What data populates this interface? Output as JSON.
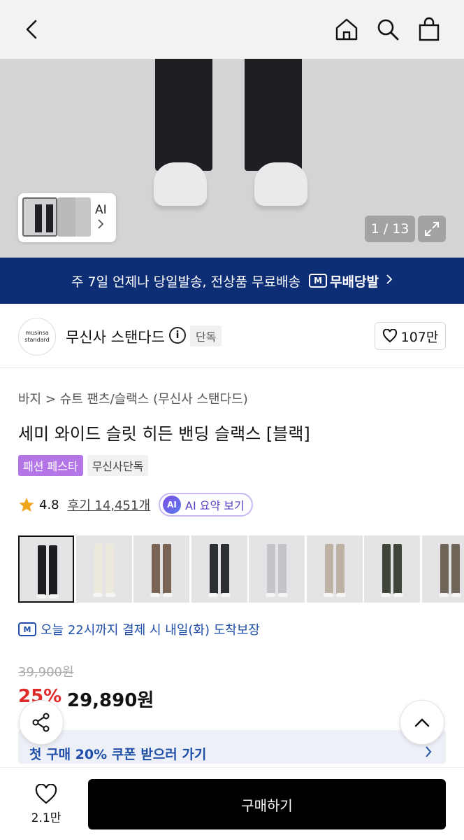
{
  "topbar": {
    "back_icon": "back-arrow-icon",
    "home_icon": "home-icon",
    "search_icon": "search-icon",
    "cart_icon": "shopping-bag-icon"
  },
  "gallery": {
    "thumb_label": "AI",
    "counter": "1 / 13"
  },
  "banner": {
    "text": "주 7일 언제나 당일발송, 전상품 무료배송",
    "badge_mark": "M",
    "badge_text": "무배당발"
  },
  "brand": {
    "logo_text": "musinsa standard",
    "name": "무신사 스탠다드",
    "info_glyph": "i",
    "exclusive_tag": "단독",
    "likes": "107만"
  },
  "product": {
    "breadcrumb": "바지 > 슈트 팬츠/슬랙스 (무신사 스탠다드)",
    "title": "세미 와이드 슬릿 히든 밴딩 슬랙스 [블랙]",
    "tags": [
      "패션 페스타",
      "무신사단독"
    ],
    "rating": "4.8",
    "reviews": "후기 14,451개",
    "ai_badge": "AI",
    "ai_summary": "AI 요약 보기"
  },
  "colors": {
    "selected": 0,
    "swatches": [
      "#1c1d20",
      "#ece8dc",
      "#7a6455",
      "#2c2f34",
      "#c3c5c8",
      "#bdb2a4",
      "#3f4539",
      "#6e6558"
    ]
  },
  "delivery": {
    "mark": "M",
    "text": "오늘 22시까지 결제 시 내일(화) 도착보장"
  },
  "pricing": {
    "original": "39,900원",
    "discount": "25%",
    "price": "29,890원"
  },
  "coupon": {
    "text": "첫 구매 20% 쿠폰 받으러 가기"
  },
  "bottom": {
    "wish_count": "2.1만",
    "buy_label": "구매하기"
  },
  "accent_colors": {
    "banner_bg": "#0d2d74",
    "festa_tag": "#b476e6",
    "discount": "#e02b2b",
    "link_blue": "#1f4fa8"
  }
}
